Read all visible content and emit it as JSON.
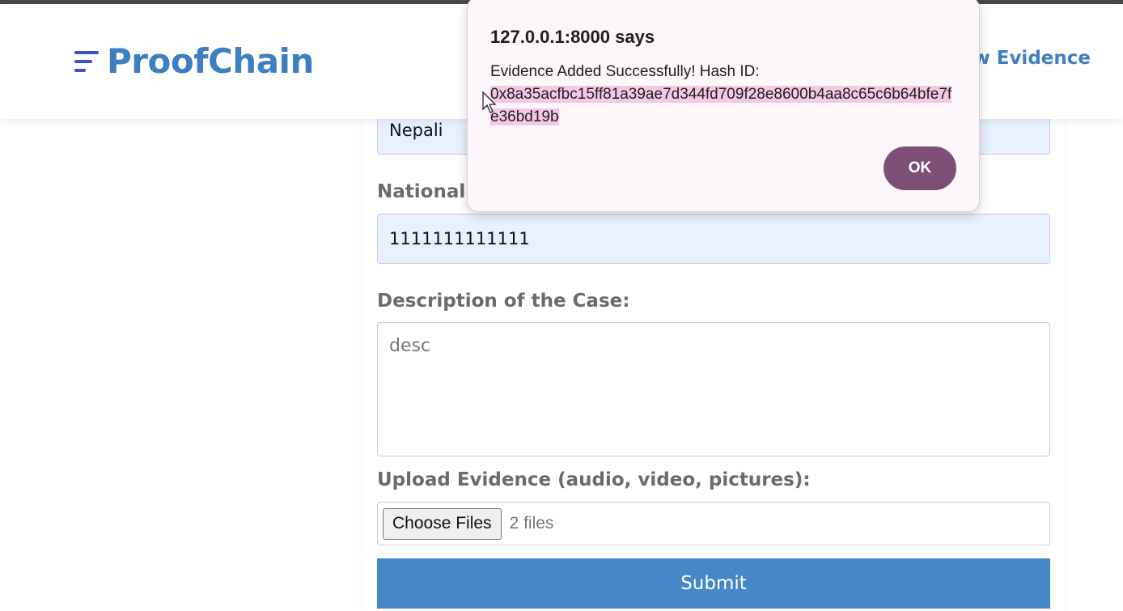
{
  "brand": {
    "name": "ProofChain"
  },
  "nav": {
    "link_label": "View Evidence"
  },
  "form": {
    "nationality_value": "Nepali",
    "national_id_label": "National ID:",
    "national_id_value": "1111111111111",
    "description_label": "Description of the Case:",
    "description_value": "desc",
    "upload_label": "Upload Evidence (audio, video, pictures):",
    "choose_files_label": "Choose Files",
    "file_status": "2 files",
    "submit_label": "Submit"
  },
  "dialog": {
    "title": "127.0.0.1:8000 says",
    "message": "Evidence Added Successfully! Hash ID:",
    "hash": "0x8a35acfbc15ff81a39ae7d344fd709f28e8600b4aa8c65c6b64bfe7fe36bd19b",
    "ok_label": "OK"
  }
}
